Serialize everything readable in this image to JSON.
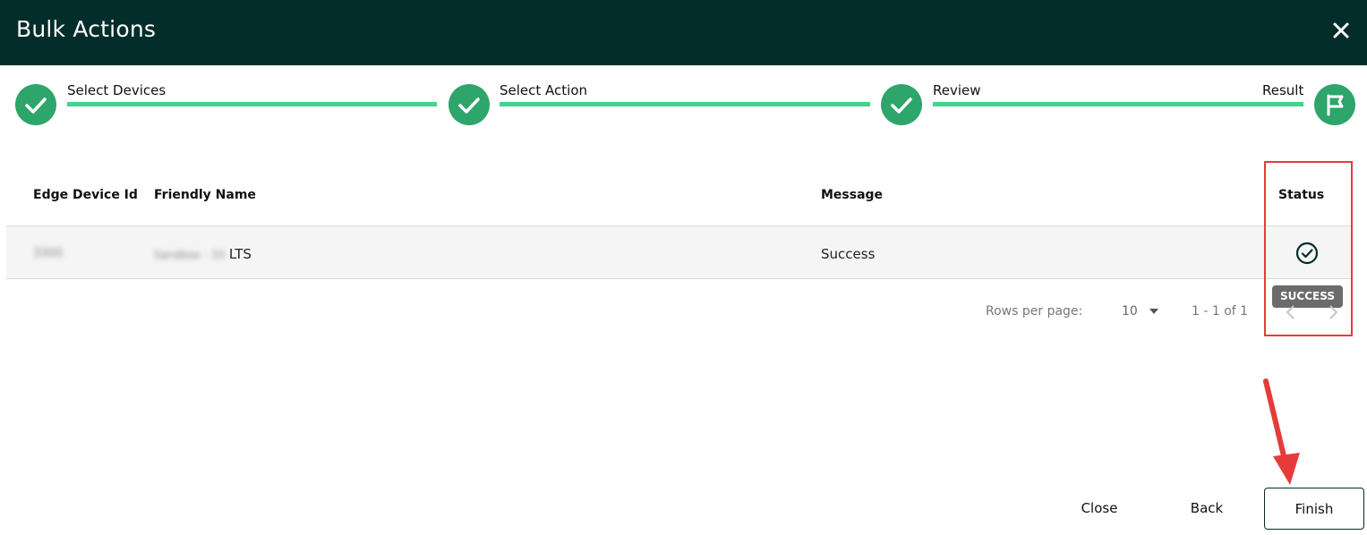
{
  "dialog": {
    "title": "Bulk Actions"
  },
  "stepper": {
    "steps": [
      {
        "label": "Select Devices",
        "state": "complete"
      },
      {
        "label": "Select Action",
        "state": "complete"
      },
      {
        "label": "Review",
        "state": "complete"
      },
      {
        "label": "Result",
        "state": "current"
      }
    ]
  },
  "table": {
    "columns": [
      "Edge Device Id",
      "Friendly Name",
      "Message",
      "Status"
    ],
    "rows": [
      {
        "edge_device_id": "3300",
        "friendly_name_blurred": "Sandbox - 33",
        "friendly_name_suffix": "LTS",
        "message": "Success",
        "status_icon": "check-circle-icon",
        "status_tooltip": "SUCCESS"
      }
    ]
  },
  "pagination": {
    "rows_per_page_label": "Rows per page:",
    "rows_per_page_value": "10",
    "range": "1 - 1 of 1"
  },
  "footer": {
    "close_label": "Close",
    "back_label": "Back",
    "finish_label": "Finish"
  },
  "colors": {
    "header_bg": "#032d2a",
    "step_complete": "#2ea56b",
    "step_line": "#44d48f",
    "annotation": "#e53b3b"
  }
}
